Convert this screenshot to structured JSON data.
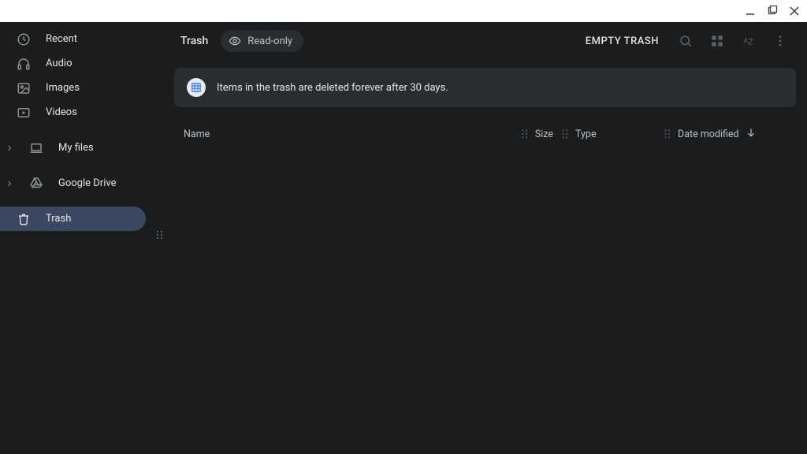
{
  "sidebar": {
    "items": [
      {
        "label": "Recent"
      },
      {
        "label": "Audio"
      },
      {
        "label": "Images"
      },
      {
        "label": "Videos"
      },
      {
        "label": "My files"
      },
      {
        "label": "Google Drive"
      },
      {
        "label": "Trash"
      }
    ]
  },
  "topbar": {
    "title": "Trash",
    "chip_label": "Read-only",
    "empty_trash": "EMPTY TRASH"
  },
  "banner": {
    "text": "Items in the trash are deleted forever after 30 days."
  },
  "columns": {
    "name": "Name",
    "size": "Size",
    "type": "Type",
    "date": "Date modified"
  }
}
